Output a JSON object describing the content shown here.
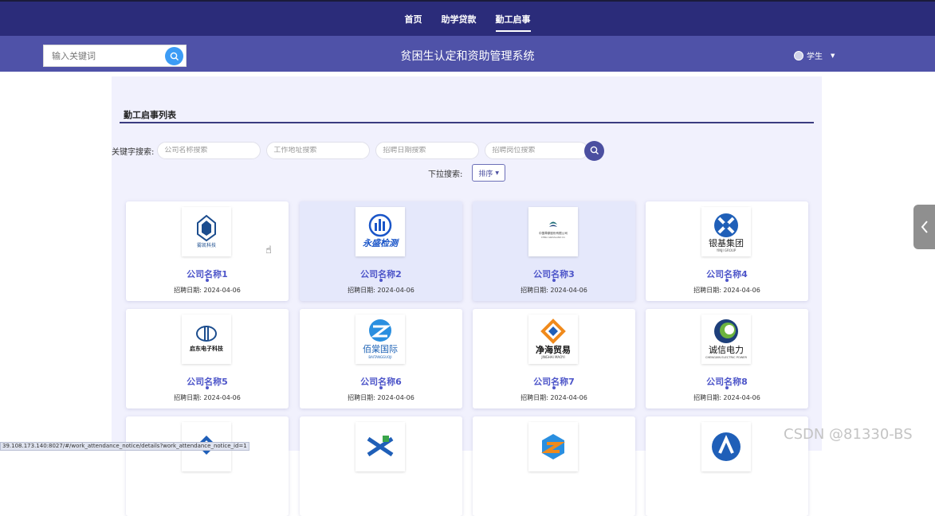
{
  "nav": {
    "items": [
      {
        "label": "首页",
        "active": false
      },
      {
        "label": "助学贷款",
        "active": false
      },
      {
        "label": "勤工启事",
        "active": true
      }
    ]
  },
  "header": {
    "search_placeholder": "输入关键词",
    "site_title": "贫困生认定和资助管理系统",
    "user_label": "学生"
  },
  "section": {
    "title": "勤工启事列表"
  },
  "filters": {
    "keyword_label": "关键字搜索:",
    "company_placeholder": "公司名称搜索",
    "address_placeholder": "工作地址搜索",
    "date_placeholder": "招聘日期搜索",
    "position_placeholder": "招聘岗位搜索",
    "dropdown_label": "下拉搜索:",
    "sort_label": "排序"
  },
  "cards": [
    {
      "name": "公司名称1",
      "date": "招聘日期: 2024-04-06",
      "logo_text": "雾凯科技"
    },
    {
      "name": "公司名称2",
      "date": "招聘日期: 2024-04-06",
      "logo_text": "永盛检测"
    },
    {
      "name": "公司名称3",
      "date": "招聘日期: 2024-04-06",
      "logo_text": "中国草原股份有限公司"
    },
    {
      "name": "公司名称4",
      "date": "招聘日期: 2024-04-06",
      "logo_text": "银基集团"
    },
    {
      "name": "公司名称5",
      "date": "招聘日期: 2024-04-06",
      "logo_text": "启东电子科技"
    },
    {
      "name": "公司名称6",
      "date": "招聘日期: 2024-04-06",
      "logo_text": "佰棠国际"
    },
    {
      "name": "公司名称7",
      "date": "招聘日期: 2024-04-06",
      "logo_text": "净海贸易"
    },
    {
      "name": "公司名称8",
      "date": "招聘日期: 2024-04-06",
      "logo_text": "诚信电力"
    }
  ],
  "status_url": "39.108.173.140:8027/#/work_attendance_notice/details?work_attendance_notice_id=1",
  "watermark": "CSDN @81330-BS",
  "colors": {
    "nav_bg": "#2b2c7a",
    "subheader_bg": "#4f52a8",
    "accent": "#4d55c9",
    "panel_bg": "#f1f1fd"
  }
}
